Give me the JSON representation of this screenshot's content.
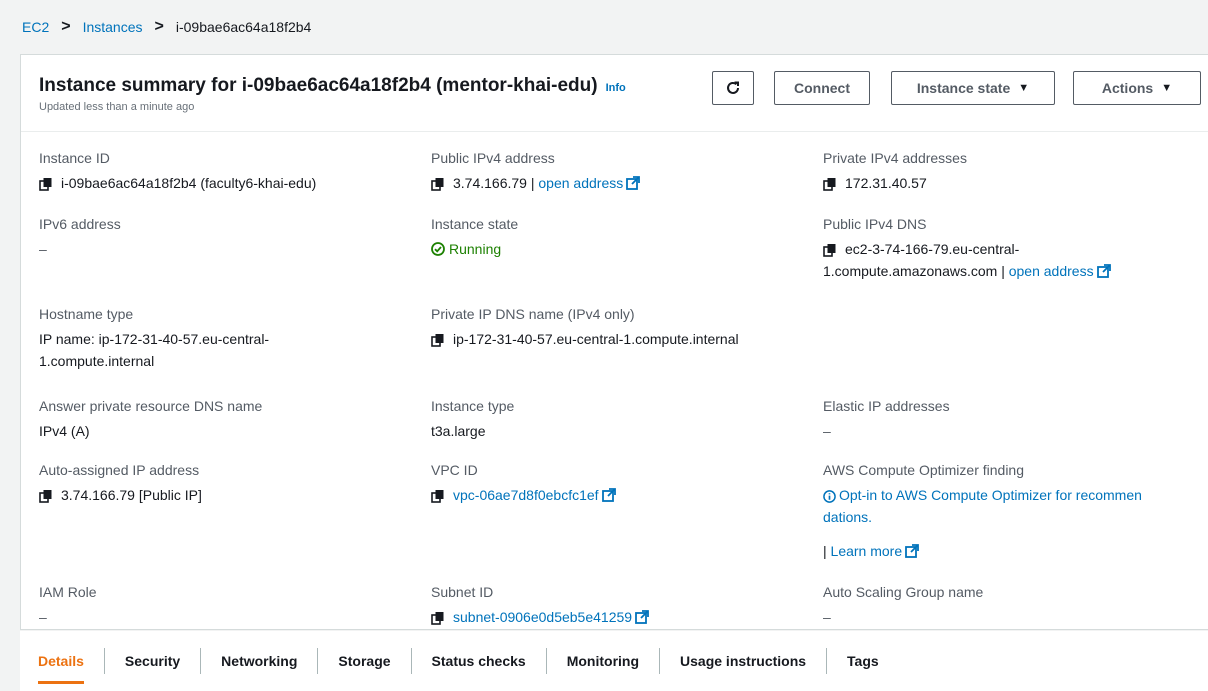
{
  "breadcrumb": {
    "items": [
      "EC2",
      "Instances"
    ],
    "current": "i-09bae6ac64a18f2b4"
  },
  "header": {
    "title": "Instance summary for i-09bae6ac64a18f2b4 (mentor-khai-edu)",
    "info_label": "Info",
    "subtitle": "Updated less than a minute ago",
    "buttons": {
      "connect": "Connect",
      "instance_state": "Instance state",
      "actions": "Actions"
    }
  },
  "fields": {
    "instance_id": {
      "label": "Instance ID",
      "value": "i-09bae6ac64a18f2b4 (faculty6-khai-edu)"
    },
    "public_ipv4": {
      "label": "Public IPv4 address",
      "value": "3.74.166.79",
      "link": "open address"
    },
    "private_ipv4": {
      "label": "Private IPv4 addresses",
      "value": "172.31.40.57"
    },
    "ipv6": {
      "label": "IPv6 address",
      "value": "–"
    },
    "instance_state": {
      "label": "Instance state",
      "value": "Running"
    },
    "public_dns": {
      "label": "Public IPv4 DNS",
      "value_line1": "ec2-3-74-166-79.eu-central-",
      "value_line2": "1.compute.amazonaws.com",
      "link": "open address"
    },
    "hostname_type": {
      "label": "Hostname type",
      "value_line1": "IP name: ip-172-31-40-57.eu-central-",
      "value_line2": "1.compute.internal"
    },
    "private_dns": {
      "label": "Private IP DNS name (IPv4 only)",
      "value": "ip-172-31-40-57.eu-central-1.compute.internal"
    },
    "answer_dns": {
      "label": "Answer private resource DNS name",
      "value": "IPv4 (A)"
    },
    "instance_type": {
      "label": "Instance type",
      "value": "t3a.large"
    },
    "elastic_ip": {
      "label": "Elastic IP addresses",
      "value": "–"
    },
    "auto_ip": {
      "label": "Auto-assigned IP address",
      "value": "3.74.166.79 [Public IP]"
    },
    "vpc_id": {
      "label": "VPC ID",
      "value": "vpc-06ae7d8f0ebcfc1ef"
    },
    "optimizer": {
      "label": "AWS Compute Optimizer finding",
      "value_line1": "Opt-in to AWS Compute Optimizer for recommen",
      "value_line2": "dations.",
      "learn_more": "Learn more"
    },
    "iam_role": {
      "label": "IAM Role",
      "value": "–"
    },
    "subnet_id": {
      "label": "Subnet ID",
      "value": "subnet-0906e0d5eb5e41259"
    },
    "asg_name": {
      "label": "Auto Scaling Group name",
      "value": "–"
    }
  },
  "tabs": [
    "Details",
    "Security",
    "Networking",
    "Storage",
    "Status checks",
    "Monitoring",
    "Usage instructions",
    "Tags"
  ],
  "colors": {
    "link": "#0073bb",
    "running": "#1d8102",
    "active_tab": "#ec7211"
  }
}
